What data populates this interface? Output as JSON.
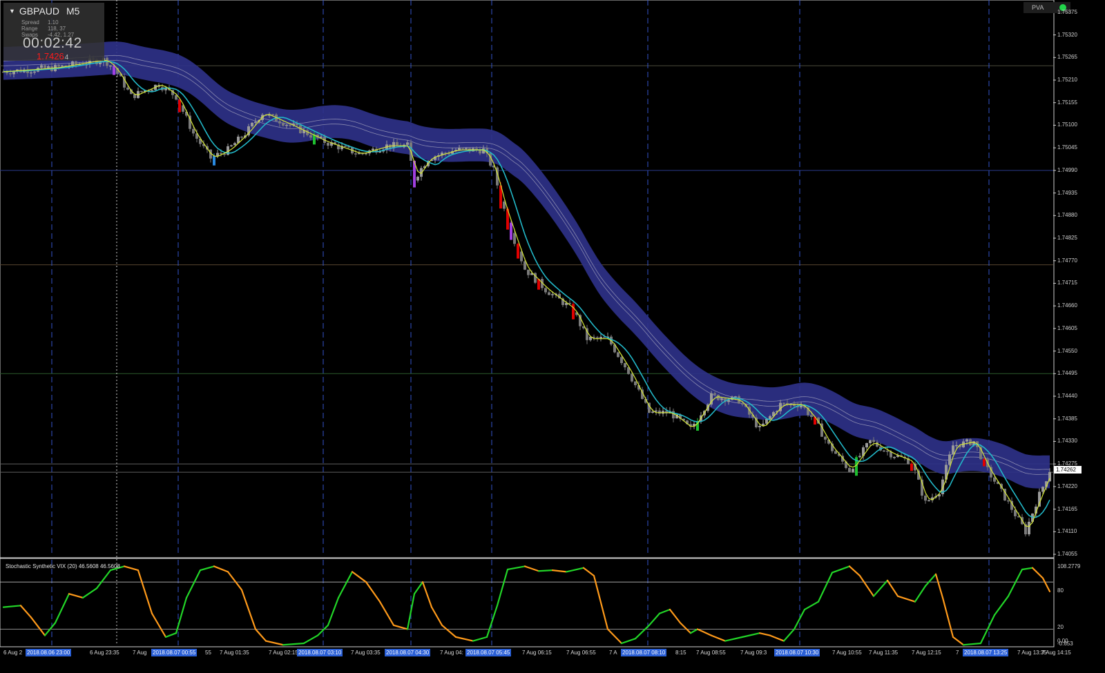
{
  "symbol": "GBPAUD",
  "timeframe": "M5",
  "info_panel": {
    "spread_label": "Spread",
    "spread_value": "1.10",
    "range_label": "Range",
    "range_value": "118, 37",
    "swaps_label": "Swaps",
    "swaps_value": "-4.42, 1.27",
    "countdown": "00:02:42",
    "price": "1.7426",
    "price_last_digit": "4"
  },
  "pva_label": "PVA",
  "price_axis": [
    "1.75375",
    "1.75320",
    "1.75265",
    "1.75210",
    "1.75155",
    "1.75100",
    "1.75045",
    "1.74990",
    "1.74935",
    "1.74880",
    "1.74825",
    "1.74770",
    "1.74715",
    "1.74660",
    "1.74605",
    "1.74550",
    "1.74495",
    "1.74440",
    "1.74385",
    "1.74330",
    "1.74275",
    "1.74220",
    "1.74165",
    "1.74110",
    "1.74055"
  ],
  "current_price": "1.74262",
  "indicator": {
    "label": "Stochastic Synthetic VIX (20) 46.5608 46.5608",
    "axis": [
      "108.2779",
      "80",
      "20",
      "0.00",
      "-0.653"
    ]
  },
  "time_axis": {
    "labels": [
      "6 Aug 2",
      "6 Aug 23:35",
      "7 Aug",
      "55",
      "7 Aug 01:35",
      "7 Aug 02:15",
      "7 Aug 03:35",
      "7 Aug 04:",
      "7 Aug 06:15",
      "7 Aug 06:55",
      "7 A",
      "8:15",
      "7 Aug 08:55",
      "7 Aug 09:3",
      "7 Aug 10:55",
      "7 Aug 11:35",
      "7 Aug 12:15",
      "7",
      "7 Aug 13:35",
      "7 Aug 14:15"
    ],
    "highlighted": [
      "2018.08.06 23:00",
      "2018.08.07 00:55",
      "2018.08.07 03:10",
      "2018.08.07 04:30",
      "2018.08.07 05:45",
      "2018.08.07 08:10",
      "2018.08.07 10:30",
      "2018.08.07 13:25"
    ]
  },
  "colors": {
    "background": "#000000",
    "band": "#2e3188",
    "fast_ma": "#d6e835",
    "slow_ma": "#22b8c8",
    "bull_candle": "#9a9a9a",
    "bear_candle": "#7a7a7a",
    "stoch_up": "#22d628",
    "stoch_down": "#ff9a1a",
    "separator": "#3355cc"
  },
  "chart_data": {
    "type": "candlestick",
    "symbol": "GBPAUD",
    "timeframe": "M5",
    "ylim": [
      1.7405,
      1.754
    ],
    "price_path": [
      [
        0,
        1.7523
      ],
      [
        80,
        1.7524
      ],
      [
        150,
        1.7526
      ],
      [
        165,
        1.7524
      ],
      [
        190,
        1.7517
      ],
      [
        230,
        1.752
      ],
      [
        255,
        1.7517
      ],
      [
        280,
        1.7508
      ],
      [
        305,
        1.7502
      ],
      [
        330,
        1.7504
      ],
      [
        355,
        1.7508
      ],
      [
        380,
        1.7513
      ],
      [
        420,
        1.751
      ],
      [
        470,
        1.7506
      ],
      [
        520,
        1.7503
      ],
      [
        560,
        1.7505
      ],
      [
        590,
        1.7505
      ],
      [
        600,
        1.7497
      ],
      [
        620,
        1.7502
      ],
      [
        660,
        1.7504
      ],
      [
        700,
        1.7504
      ],
      [
        715,
        1.7499
      ],
      [
        725,
        1.7492
      ],
      [
        745,
        1.7482
      ],
      [
        760,
        1.7475
      ],
      [
        790,
        1.747
      ],
      [
        830,
        1.7465
      ],
      [
        850,
        1.7458
      ],
      [
        880,
        1.7458
      ],
      [
        910,
        1.745
      ],
      [
        940,
        1.744
      ],
      [
        970,
        1.744
      ],
      [
        1000,
        1.7436
      ],
      [
        1030,
        1.7444
      ],
      [
        1070,
        1.7443
      ],
      [
        1100,
        1.7436
      ],
      [
        1130,
        1.7442
      ],
      [
        1160,
        1.7442
      ],
      [
        1180,
        1.7438
      ],
      [
        1200,
        1.7432
      ],
      [
        1230,
        1.7426
      ],
      [
        1260,
        1.7433
      ],
      [
        1290,
        1.743
      ],
      [
        1320,
        1.7428
      ],
      [
        1340,
        1.7418
      ],
      [
        1360,
        1.7421
      ],
      [
        1380,
        1.7432
      ],
      [
        1410,
        1.7433
      ],
      [
        1430,
        1.7426
      ],
      [
        1460,
        1.7418
      ],
      [
        1485,
        1.7411
      ],
      [
        1500,
        1.7418
      ],
      [
        1520,
        1.7426
      ]
    ],
    "marked_bars": [
      {
        "x": 165,
        "type": "purple"
      },
      {
        "x": 258,
        "type": "red"
      },
      {
        "x": 312,
        "type": "blue"
      },
      {
        "x": 455,
        "type": "green"
      },
      {
        "x": 600,
        "type": "purple"
      },
      {
        "x": 727,
        "type": "red"
      },
      {
        "x": 734,
        "type": "red"
      },
      {
        "x": 742,
        "type": "purple"
      },
      {
        "x": 750,
        "type": "red"
      },
      {
        "x": 782,
        "type": "red"
      },
      {
        "x": 828,
        "type": "red"
      },
      {
        "x": 1008,
        "type": "green"
      },
      {
        "x": 1182,
        "type": "red"
      },
      {
        "x": 1238,
        "type": "green"
      },
      {
        "x": 1322,
        "type": "red"
      },
      {
        "x": 1424,
        "type": "red"
      }
    ],
    "horizontal_levels": [
      {
        "price": 1.75245,
        "color": "#4a4a3a"
      },
      {
        "price": 1.7499,
        "color": "#2a3a8a"
      },
      {
        "price": 1.7476,
        "color": "#5a4630"
      },
      {
        "price": 1.74495,
        "color": "#2a5a2a"
      },
      {
        "price": 1.74275,
        "color": "#606060"
      },
      {
        "price": 1.74255,
        "color": "#606060"
      }
    ],
    "stochastic": {
      "ylim": [
        -0.653,
        108.2779
      ],
      "levels": [
        80,
        20
      ],
      "path": [
        [
          5,
          48
        ],
        [
          30,
          50
        ],
        [
          45,
          35
        ],
        [
          65,
          12
        ],
        [
          80,
          28
        ],
        [
          100,
          65
        ],
        [
          120,
          60
        ],
        [
          140,
          72
        ],
        [
          160,
          95
        ],
        [
          180,
          100
        ],
        [
          200,
          95
        ],
        [
          220,
          40
        ],
        [
          240,
          10
        ],
        [
          255,
          15
        ],
        [
          270,
          60
        ],
        [
          290,
          95
        ],
        [
          310,
          100
        ],
        [
          330,
          93
        ],
        [
          350,
          70
        ],
        [
          370,
          20
        ],
        [
          385,
          5
        ],
        [
          410,
          0
        ],
        [
          440,
          2
        ],
        [
          460,
          12
        ],
        [
          475,
          25
        ],
        [
          490,
          60
        ],
        [
          510,
          93
        ],
        [
          530,
          80
        ],
        [
          550,
          55
        ],
        [
          570,
          25
        ],
        [
          590,
          20
        ],
        [
          600,
          65
        ],
        [
          612,
          80
        ],
        [
          625,
          48
        ],
        [
          640,
          25
        ],
        [
          660,
          10
        ],
        [
          685,
          5
        ],
        [
          705,
          10
        ],
        [
          720,
          50
        ],
        [
          735,
          96
        ],
        [
          760,
          100
        ],
        [
          780,
          94
        ],
        [
          800,
          95
        ],
        [
          820,
          93
        ],
        [
          845,
          98
        ],
        [
          860,
          88
        ],
        [
          880,
          20
        ],
        [
          900,
          2
        ],
        [
          920,
          8
        ],
        [
          940,
          25
        ],
        [
          955,
          40
        ],
        [
          970,
          45
        ],
        [
          985,
          28
        ],
        [
          1000,
          15
        ],
        [
          1010,
          20
        ],
        [
          1030,
          12
        ],
        [
          1050,
          5
        ],
        [
          1075,
          10
        ],
        [
          1100,
          15
        ],
        [
          1115,
          12
        ],
        [
          1135,
          5
        ],
        [
          1150,
          20
        ],
        [
          1165,
          45
        ],
        [
          1185,
          55
        ],
        [
          1205,
          92
        ],
        [
          1230,
          100
        ],
        [
          1245,
          88
        ],
        [
          1265,
          62
        ],
        [
          1285,
          82
        ],
        [
          1300,
          62
        ],
        [
          1325,
          55
        ],
        [
          1340,
          75
        ],
        [
          1355,
          90
        ],
        [
          1365,
          60
        ],
        [
          1380,
          10
        ],
        [
          1395,
          0
        ],
        [
          1420,
          2
        ],
        [
          1440,
          38
        ],
        [
          1460,
          62
        ],
        [
          1480,
          96
        ],
        [
          1495,
          98
        ],
        [
          1510,
          85
        ],
        [
          1520,
          68
        ]
      ]
    }
  }
}
